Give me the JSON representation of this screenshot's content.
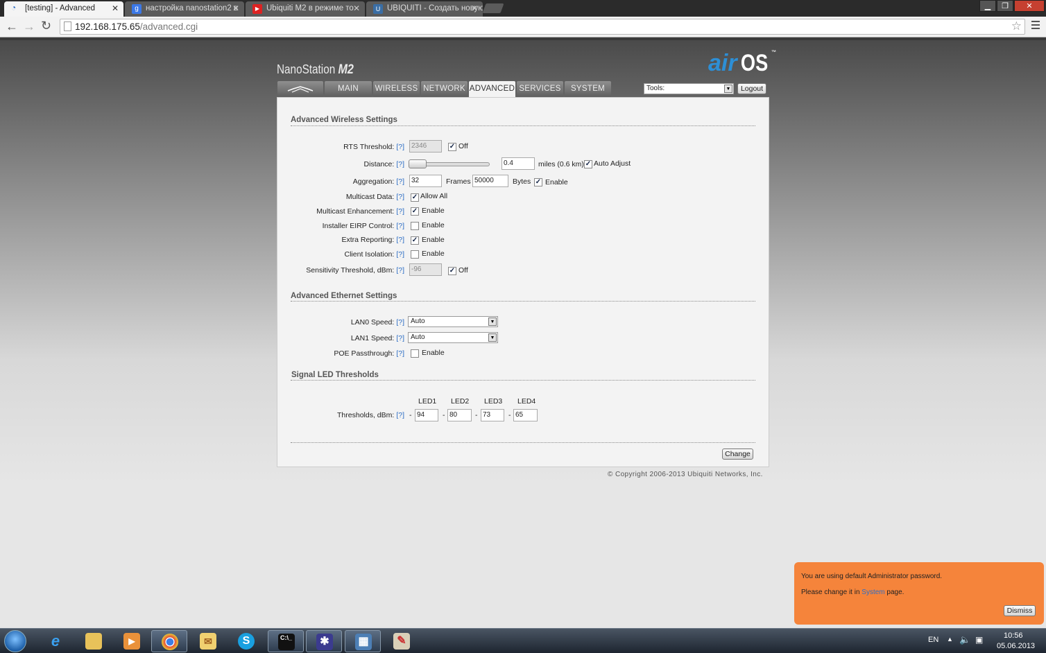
{
  "browser": {
    "tabs": [
      {
        "title": "[testing] - Advanced",
        "active": true
      },
      {
        "title": "настройка nanostation2 в",
        "active": false
      },
      {
        "title": "Ubiquiti M2 в режиме то",
        "active": false
      },
      {
        "title": "UBIQUITI - Создать новую",
        "active": false
      }
    ],
    "url_host": "192.168.175.65",
    "url_path": "/advanced.cgi"
  },
  "header": {
    "brand": "NanoStation",
    "model": "M2",
    "logo_air": "air",
    "logo_os": "OS",
    "logo_tm": "™"
  },
  "nav": {
    "tabs": [
      "MAIN",
      "WIRELESS",
      "NETWORK",
      "ADVANCED",
      "SERVICES",
      "SYSTEM"
    ],
    "active": "ADVANCED",
    "tools_label": "Tools:",
    "logout": "Logout"
  },
  "help": "[?]",
  "wireless": {
    "title": "Advanced Wireless Settings",
    "rts": {
      "label": "RTS Threshold:",
      "value": "2346",
      "off_label": "Off",
      "off_checked": true
    },
    "distance": {
      "label": "Distance:",
      "value": "0.4",
      "unit": "miles (0.6 km)",
      "auto_label": "Auto Adjust",
      "auto_checked": true
    },
    "aggregation": {
      "label": "Aggregation:",
      "frames": "32",
      "frames_label": "Frames",
      "bytes": "50000",
      "bytes_label": "Bytes",
      "enable_label": "Enable",
      "enable_checked": true
    },
    "multicast_data": {
      "label": "Multicast Data:",
      "opt": "Allow All",
      "checked": true
    },
    "multicast_enh": {
      "label": "Multicast Enhancement:",
      "opt": "Enable",
      "checked": true
    },
    "eirp": {
      "label": "Installer EIRP Control:",
      "opt": "Enable",
      "checked": false
    },
    "extra": {
      "label": "Extra Reporting:",
      "opt": "Enable",
      "checked": true
    },
    "isolation": {
      "label": "Client Isolation:",
      "opt": "Enable",
      "checked": false
    },
    "sensitivity": {
      "label": "Sensitivity Threshold, dBm:",
      "value": "-96",
      "off_label": "Off",
      "off_checked": true
    }
  },
  "ethernet": {
    "title": "Advanced Ethernet Settings",
    "lan0": {
      "label": "LAN0 Speed:",
      "value": "Auto"
    },
    "lan1": {
      "label": "LAN1 Speed:",
      "value": "Auto"
    },
    "poe": {
      "label": "POE Passthrough:",
      "opt": "Enable",
      "checked": false
    }
  },
  "led": {
    "title": "Signal LED Thresholds",
    "headers": [
      "LED1",
      "LED2",
      "LED3",
      "LED4"
    ],
    "label": "Thresholds, dBm:",
    "dash": "-",
    "values": [
      "94",
      "80",
      "73",
      "65"
    ]
  },
  "change_button": "Change",
  "copyright": "© Copyright 2006-2013 Ubiquiti Networks, Inc.",
  "notification": {
    "line1": "You are using default Administrator password.",
    "line2_pre": "Please change it in",
    "line2_link": "System",
    "line2_post": "page.",
    "dismiss": "Dismiss"
  },
  "taskbar": {
    "lang": "EN",
    "time": "10:56",
    "date": "05.06.2013"
  }
}
